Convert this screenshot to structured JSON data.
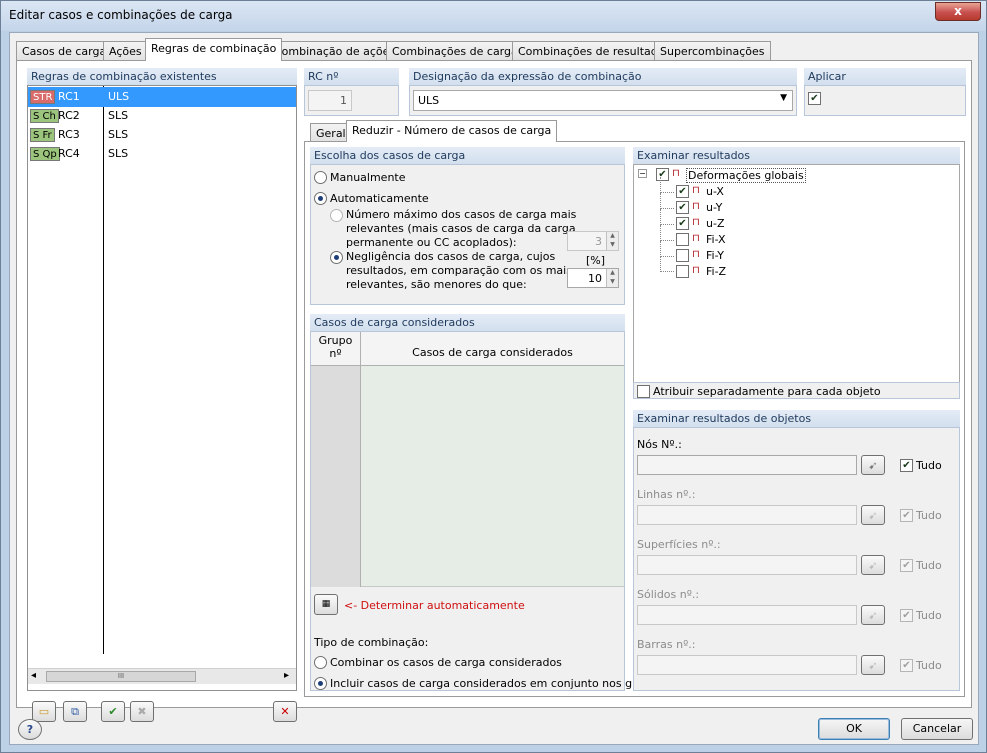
{
  "window": {
    "title": "Editar casos e combinações de carga",
    "close_glyph": "x"
  },
  "tabs": [
    "Casos de carga",
    "Ações",
    "Regras de combinação",
    "Combinação de ações",
    "Combinações de cargas",
    "Combinações de resultados",
    "Supercombinações"
  ],
  "left_panel": {
    "header": "Regras de combinação existentes",
    "rules": [
      {
        "badge": "STR",
        "badge_color": "#d96b6b",
        "id": "RC1",
        "desc": "ULS",
        "selected": true
      },
      {
        "badge": "S Ch",
        "badge_color": "#9bc47c",
        "id": "RC2",
        "desc": "SLS",
        "selected": false
      },
      {
        "badge": "S Fr",
        "badge_color": "#9bc47c",
        "id": "RC3",
        "desc": "SLS",
        "selected": false
      },
      {
        "badge": "S Qp",
        "badge_color": "#9bc47c",
        "id": "RC4",
        "desc": "SLS",
        "selected": false
      }
    ],
    "scroll_left": "◂",
    "scroll_thumb": "III",
    "scroll_right": "▸"
  },
  "rc": {
    "label": "RC nº",
    "value": "1"
  },
  "designation": {
    "label": "Designação da expressão de combinação",
    "value": "ULS"
  },
  "apply": {
    "label": "Aplicar",
    "checked": true
  },
  "subtabs": [
    "Geral",
    "Reduzir - Número de casos de carga"
  ],
  "choice": {
    "header": "Escolha dos casos de carga",
    "manual": "Manualmente",
    "auto": "Automaticamente",
    "opt1": [
      "Número máximo dos casos de carga mais",
      "relevantes (mais casos de carga da carga",
      "permanente ou CC acoplados):"
    ],
    "opt1_value": "3",
    "opt2": [
      "Negligência dos casos de carga, cujos",
      "resultados, em comparação com os mais",
      "relevantes, são menores do que:"
    ],
    "opt2_unit": "[%]",
    "opt2_value": "10"
  },
  "considered": {
    "header": "Casos de carga considerados",
    "col1": [
      "Grupo",
      "nº"
    ],
    "col2": "Casos de carga considerados",
    "auto_link": "<- Determinar automaticamente",
    "combo_label": "Tipo de combinação:",
    "combo_opt1": "Combinar os casos de carga considerados",
    "combo_opt2": "Incluir casos de carga considerados em conjunto nos grupos"
  },
  "results": {
    "header": "Examinar resultados",
    "root": "Deformações globais",
    "items": [
      {
        "label": "u-X",
        "checked": true
      },
      {
        "label": "u-Y",
        "checked": true
      },
      {
        "label": "u-Z",
        "checked": true
      },
      {
        "label": "Fi-X",
        "checked": false
      },
      {
        "label": "Fi-Y",
        "checked": false
      },
      {
        "label": "Fi-Z",
        "checked": false
      }
    ],
    "separate": "Atribuir separadamente para cada objeto"
  },
  "objects": {
    "header": "Examinar resultados de objetos",
    "all_label": "Tudo",
    "rows": [
      {
        "label": "Nós Nº.:",
        "enabled": true
      },
      {
        "label": "Linhas nº.:",
        "enabled": false
      },
      {
        "label": "Superfícies nº.:",
        "enabled": false
      },
      {
        "label": "Sólidos nº.:",
        "enabled": false
      },
      {
        "label": "Barras nº.:",
        "enabled": false
      }
    ]
  },
  "footer": {
    "ok": "OK",
    "cancel": "Cancelar",
    "help": "?"
  },
  "colors": {
    "selection": "#3399ff",
    "header_text": "#1e395b",
    "link": "#d01010"
  }
}
